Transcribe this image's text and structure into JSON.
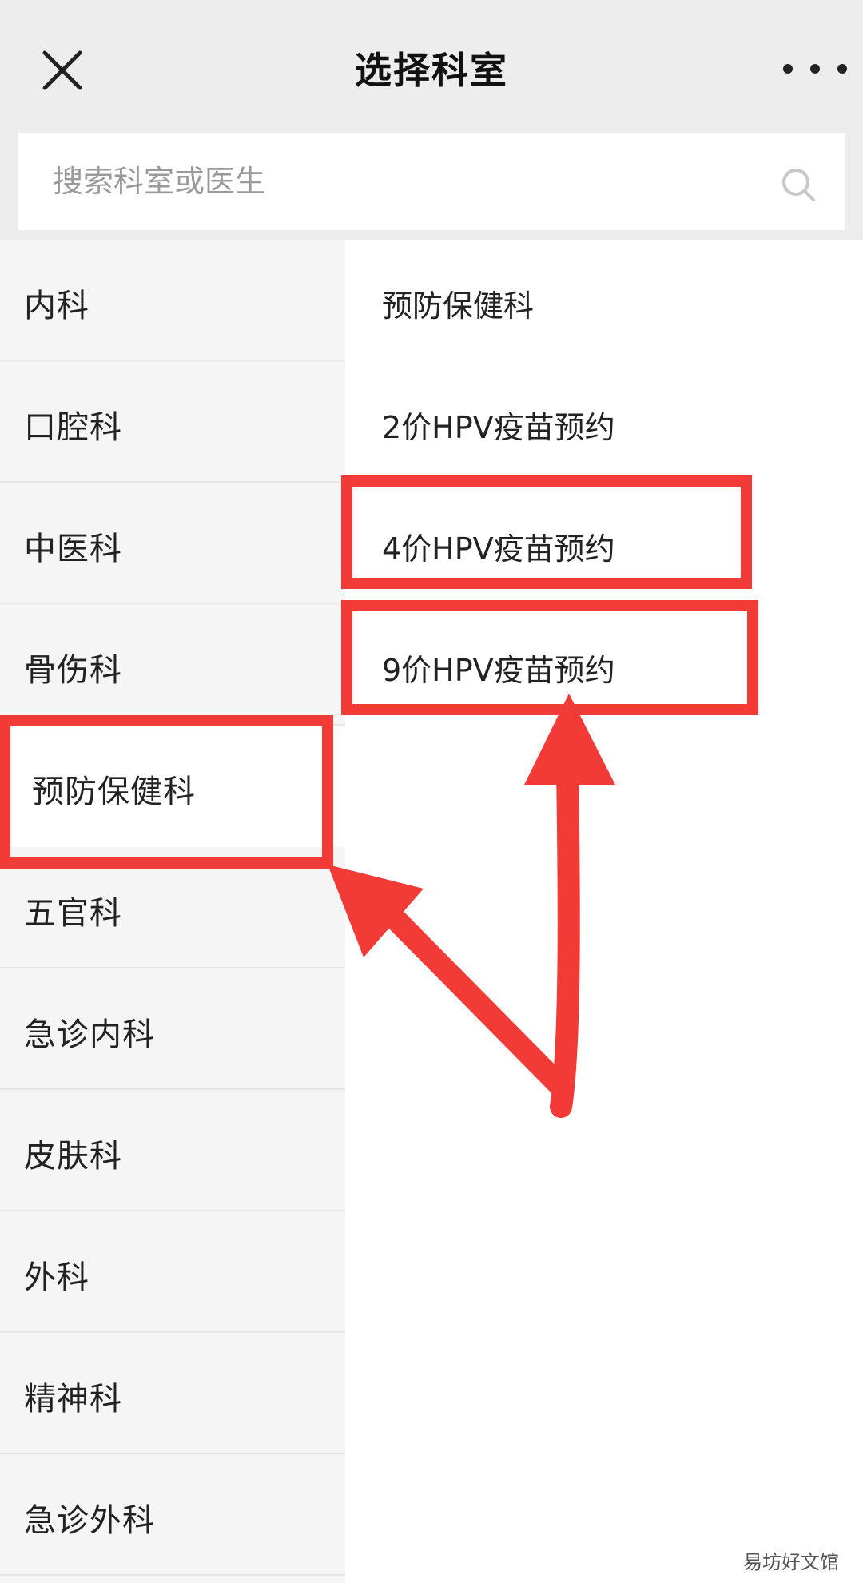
{
  "header": {
    "title": "选择科室",
    "close_icon": "close-icon",
    "more_icon": "more-icon"
  },
  "search": {
    "placeholder": "搜索科室或医生",
    "icon": "search-icon"
  },
  "departments": [
    {
      "label": "内科"
    },
    {
      "label": "口腔科"
    },
    {
      "label": "中医科"
    },
    {
      "label": "骨伤科"
    },
    {
      "label": "预防保健科",
      "active": true
    },
    {
      "label": "五官科"
    },
    {
      "label": "急诊内科"
    },
    {
      "label": "皮肤科"
    },
    {
      "label": "外科"
    },
    {
      "label": "精神科"
    },
    {
      "label": "急诊外科"
    }
  ],
  "sub_departments": [
    {
      "label": "预防保健科"
    },
    {
      "label": "2价HPV疫苗预约"
    },
    {
      "label": "4价HPV疫苗预约",
      "highlighted": true
    },
    {
      "label": "9价HPV疫苗预约",
      "highlighted": true
    }
  ],
  "annotation": {
    "color": "#f23b36"
  },
  "watermark": "易坊好文馆"
}
